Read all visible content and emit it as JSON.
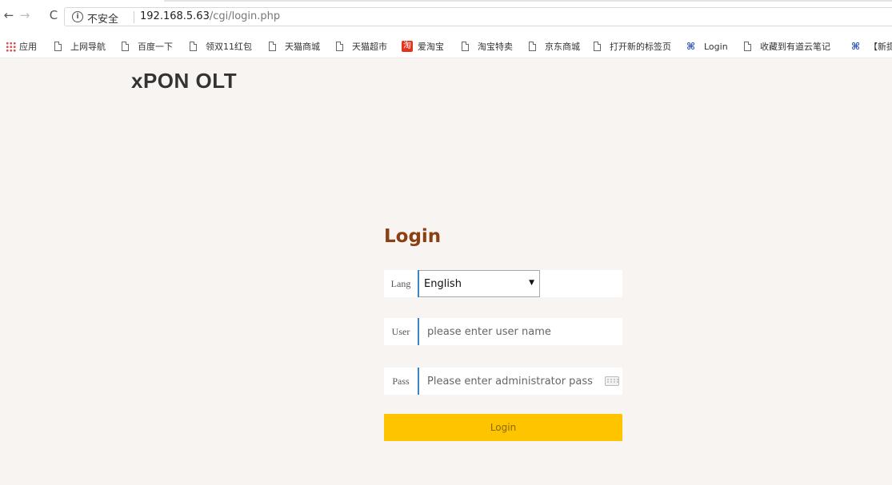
{
  "browser": {
    "security_label": "不安全",
    "url_host": "192.168.5.63",
    "url_path": "/cgi/login.php",
    "bookmarks": [
      {
        "label": "应用",
        "icon": "apps-grid-icon"
      },
      {
        "label": "上网导航",
        "icon": "page-icon"
      },
      {
        "label": "百度一下",
        "icon": "page-icon"
      },
      {
        "label": "领双11红包",
        "icon": "page-icon"
      },
      {
        "label": "天猫商城",
        "icon": "page-icon"
      },
      {
        "label": "天猫超市",
        "icon": "page-icon"
      },
      {
        "label": "爱淘宝",
        "icon": "taobao-icon",
        "icon_text": "淘"
      },
      {
        "label": "淘宝特卖",
        "icon": "page-icon"
      },
      {
        "label": "京东商城",
        "icon": "page-icon"
      },
      {
        "label": "打开新的标签页",
        "icon": "page-icon"
      },
      {
        "label": "Login",
        "icon": "brand-icon"
      },
      {
        "label": "收藏到有道云笔记",
        "icon": "page-icon"
      },
      {
        "label": "【新提",
        "icon": "brand-icon"
      }
    ]
  },
  "app": {
    "title": "xPON OLT"
  },
  "login": {
    "heading": "Login",
    "lang_label": "Lang",
    "lang_value": "English",
    "user_label": "User",
    "user_placeholder": "please enter user name",
    "pass_label": "Pass",
    "pass_placeholder": "Please enter administrator password",
    "button_label": "Login"
  },
  "colors": {
    "page_background": "#f8f4f2",
    "heading": "#8b3f12",
    "accent_border": "#3a85c8",
    "button": "#ffc400"
  }
}
